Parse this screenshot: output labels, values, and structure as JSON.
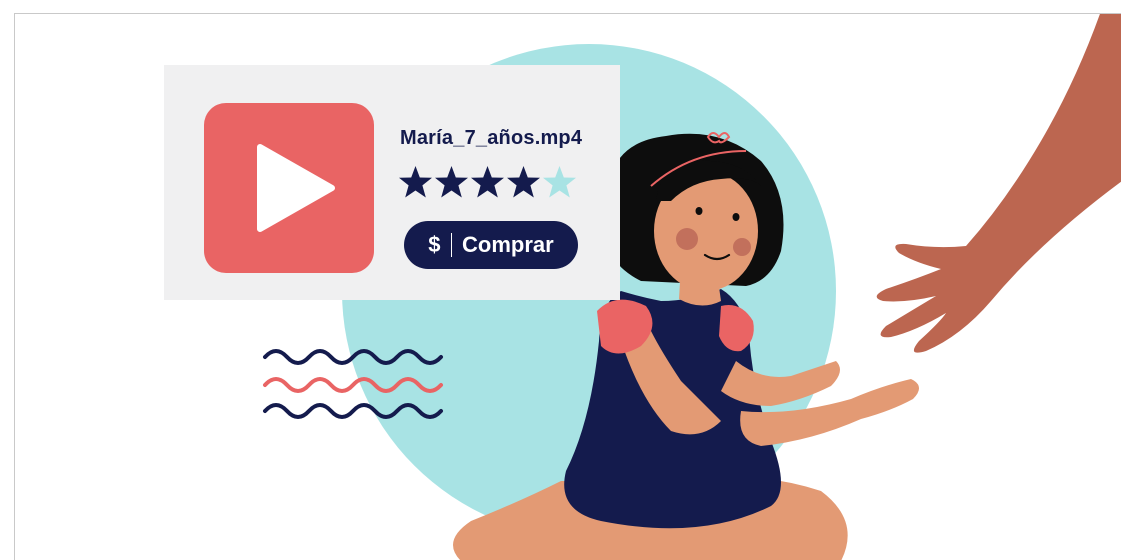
{
  "video_card": {
    "filename": "María_7_años.mp4",
    "rating": 4,
    "rating_max": 5,
    "buy_button": {
      "currency_symbol": "$",
      "label": "Comprar"
    }
  },
  "colors": {
    "play_button": "#e96464",
    "navy": "#141b4d",
    "star_empty": "#a8e3e4",
    "circle": "#a8e3e4",
    "card_bg": "#f0f0f1",
    "hand": "#bc6650",
    "skin": "#e39a74",
    "sleeve": "#ea6464"
  },
  "icons": {
    "play": "play-icon",
    "star": "star-icon",
    "wave": "wave-lines-icon"
  }
}
